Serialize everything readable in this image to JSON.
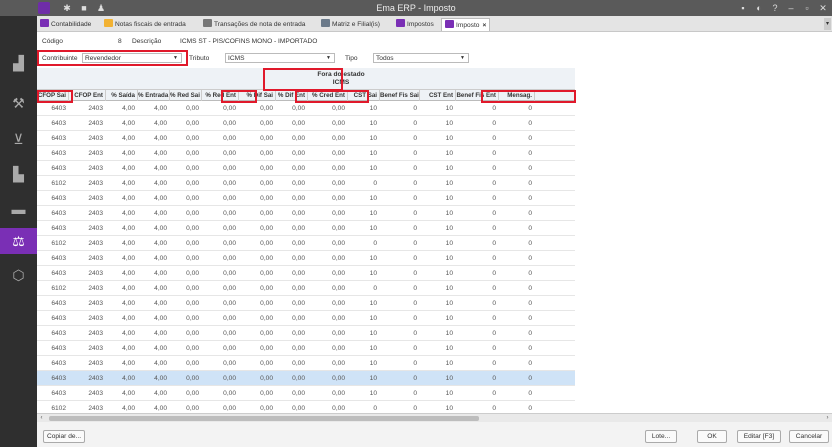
{
  "window": {
    "title": "Ema ERP - Imposto"
  },
  "tabs": [
    {
      "label": "Contabilidade",
      "color": "#7a2fb5"
    },
    {
      "label": "Notas fiscais de entrada",
      "color": "#f2b233"
    },
    {
      "label": "Transações  de nota de entrada",
      "color": "#777777"
    },
    {
      "label": "Matriz e Filial(is)",
      "color": "#6b7a8a"
    },
    {
      "label": "Impostos",
      "color": "#7a2fb5"
    },
    {
      "label": "Imposto",
      "color": "#7a2fb5",
      "close": "×"
    }
  ],
  "form": {
    "codigo_label": "Código",
    "codigo_value": "8",
    "descricao_label": "Descrição",
    "descricao_value": "ICMS ST - PIS/COFINS MONO - IMPORTADO",
    "contribuinte_label": "Contribuinte",
    "contribuinte_value": "Revendedor",
    "tributo_label": "Tributo",
    "tributo_value": "ICMS",
    "tipo_label": "Tipo",
    "tipo_value": "Todos"
  },
  "grid": {
    "group_header_line1": "Fora do estado",
    "group_header_line2": "ICMS",
    "columns": [
      "CFOP Sai",
      "CFOP Ent",
      "% Saída",
      "% Entrada",
      "% Red Sai",
      "% Red Ent",
      "% Dif Sai",
      "% Dif Ent",
      "% Cred Ent",
      "CST Sai",
      "Benef Fis Sai",
      "CST Ent",
      "Benef Fis Ent",
      "Mensag."
    ],
    "rows": [
      [
        "6403",
        "2403",
        "4,00",
        "4,00",
        "0,00",
        "0,00",
        "0,00",
        "0,00",
        "0,00",
        "10",
        "0",
        "10",
        "0",
        "0"
      ],
      [
        "6403",
        "2403",
        "4,00",
        "4,00",
        "0,00",
        "0,00",
        "0,00",
        "0,00",
        "0,00",
        "10",
        "0",
        "10",
        "0",
        "0"
      ],
      [
        "6403",
        "2403",
        "4,00",
        "4,00",
        "0,00",
        "0,00",
        "0,00",
        "0,00",
        "0,00",
        "10",
        "0",
        "10",
        "0",
        "0"
      ],
      [
        "6403",
        "2403",
        "4,00",
        "4,00",
        "0,00",
        "0,00",
        "0,00",
        "0,00",
        "0,00",
        "10",
        "0",
        "10",
        "0",
        "0"
      ],
      [
        "6403",
        "2403",
        "4,00",
        "4,00",
        "0,00",
        "0,00",
        "0,00",
        "0,00",
        "0,00",
        "10",
        "0",
        "10",
        "0",
        "0"
      ],
      [
        "6102",
        "2403",
        "4,00",
        "4,00",
        "0,00",
        "0,00",
        "0,00",
        "0,00",
        "0,00",
        "0",
        "0",
        "10",
        "0",
        "0"
      ],
      [
        "6403",
        "2403",
        "4,00",
        "4,00",
        "0,00",
        "0,00",
        "0,00",
        "0,00",
        "0,00",
        "10",
        "0",
        "10",
        "0",
        "0"
      ],
      [
        "6403",
        "2403",
        "4,00",
        "4,00",
        "0,00",
        "0,00",
        "0,00",
        "0,00",
        "0,00",
        "10",
        "0",
        "10",
        "0",
        "0"
      ],
      [
        "6403",
        "2403",
        "4,00",
        "4,00",
        "0,00",
        "0,00",
        "0,00",
        "0,00",
        "0,00",
        "10",
        "0",
        "10",
        "0",
        "0"
      ],
      [
        "6102",
        "2403",
        "4,00",
        "4,00",
        "0,00",
        "0,00",
        "0,00",
        "0,00",
        "0,00",
        "0",
        "0",
        "10",
        "0",
        "0"
      ],
      [
        "6403",
        "2403",
        "4,00",
        "4,00",
        "0,00",
        "0,00",
        "0,00",
        "0,00",
        "0,00",
        "10",
        "0",
        "10",
        "0",
        "0"
      ],
      [
        "6403",
        "2403",
        "4,00",
        "4,00",
        "0,00",
        "0,00",
        "0,00",
        "0,00",
        "0,00",
        "10",
        "0",
        "10",
        "0",
        "0"
      ],
      [
        "6102",
        "2403",
        "4,00",
        "4,00",
        "0,00",
        "0,00",
        "0,00",
        "0,00",
        "0,00",
        "0",
        "0",
        "10",
        "0",
        "0"
      ],
      [
        "6403",
        "2403",
        "4,00",
        "4,00",
        "0,00",
        "0,00",
        "0,00",
        "0,00",
        "0,00",
        "10",
        "0",
        "10",
        "0",
        "0"
      ],
      [
        "6403",
        "2403",
        "4,00",
        "4,00",
        "0,00",
        "0,00",
        "0,00",
        "0,00",
        "0,00",
        "10",
        "0",
        "10",
        "0",
        "0"
      ],
      [
        "6403",
        "2403",
        "4,00",
        "4,00",
        "0,00",
        "0,00",
        "0,00",
        "0,00",
        "0,00",
        "10",
        "0",
        "10",
        "0",
        "0"
      ],
      [
        "6403",
        "2403",
        "4,00",
        "4,00",
        "0,00",
        "0,00",
        "0,00",
        "0,00",
        "0,00",
        "10",
        "0",
        "10",
        "0",
        "0"
      ],
      [
        "6403",
        "2403",
        "4,00",
        "4,00",
        "0,00",
        "0,00",
        "0,00",
        "0,00",
        "0,00",
        "10",
        "0",
        "10",
        "0",
        "0"
      ],
      [
        "6403",
        "2403",
        "4,00",
        "4,00",
        "0,00",
        "0,00",
        "0,00",
        "0,00",
        "0,00",
        "10",
        "0",
        "10",
        "0",
        "0"
      ],
      [
        "6403",
        "2403",
        "4,00",
        "4,00",
        "0,00",
        "0,00",
        "0,00",
        "0,00",
        "0,00",
        "10",
        "0",
        "10",
        "0",
        "0"
      ],
      [
        "6102",
        "2403",
        "4,00",
        "4,00",
        "0,00",
        "0,00",
        "0,00",
        "0,00",
        "0,00",
        "0",
        "0",
        "10",
        "0",
        "0"
      ]
    ],
    "selected_row": 18
  },
  "buttons": {
    "copiar": "Copiar de...",
    "lote": "Lote...",
    "ok": "OK",
    "editar": "Editar [F3]",
    "cancelar": "Cancelar"
  },
  "colors": {
    "accent": "#7a2fb5",
    "highlight": "#e0192b",
    "selected_row": "#cfe3f7"
  }
}
